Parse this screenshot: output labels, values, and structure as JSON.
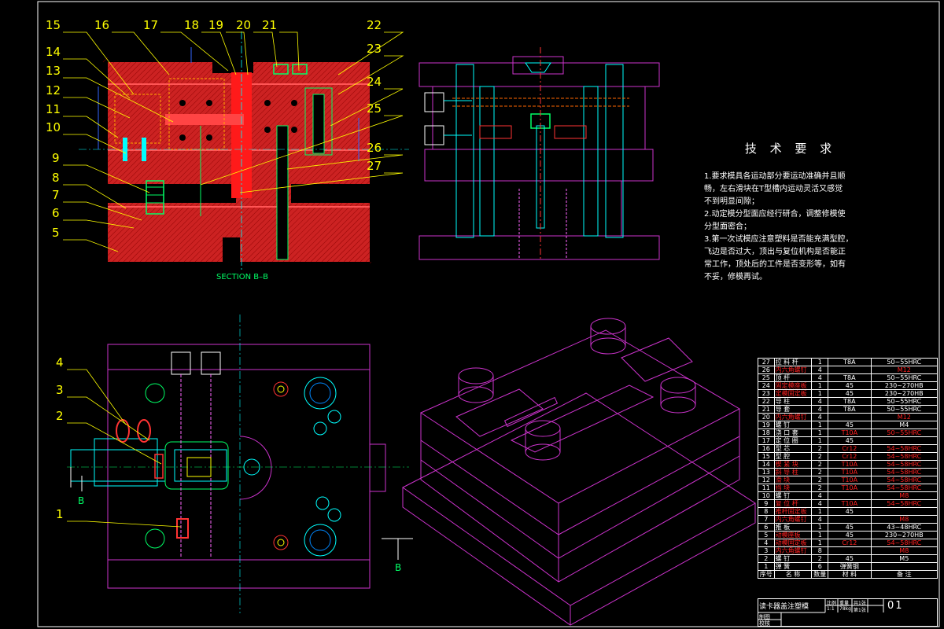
{
  "colors": {
    "background": "#000000",
    "frame": "#ffffff",
    "part_red": "#cc2222",
    "leader_yellow": "#ffff00",
    "outline_magenta": "#cc33cc",
    "outline_cyan": "#00ffff",
    "dim_green": "#00ff66",
    "text_white": "#ffffff"
  },
  "section_label": "SECTION B–B",
  "section_markers": [
    "B",
    "B"
  ],
  "callouts_top": [
    "15",
    "16",
    "17",
    "18",
    "19",
    "20",
    "21",
    "22",
    "23",
    "14",
    "13",
    "12",
    "11",
    "10",
    "24",
    "25",
    "26",
    "27",
    "9",
    "8",
    "7",
    "6",
    "5"
  ],
  "callouts_bottom": [
    "4",
    "3",
    "2",
    "1"
  ],
  "tech": {
    "title": "技 术 要 求",
    "lines": [
      "1.要求模具各运动部分要运动准确并且顺",
      "畅，左右滑块在T型槽内运动灵活又感觉",
      "不到明显间隙；",
      "2.动定模分型面应经行研合，调整修模使",
      "分型面密合；",
      "3.第一次试模应注意塑料是否能充满型腔，",
      "飞边是否过大，顶出与复位机构是否能正",
      "常工作，顶处后的工件是否变形等，如有",
      "不妥，修模再试。"
    ]
  },
  "bom": {
    "rows": [
      {
        "no": "27",
        "name": "拉 料 杆",
        "qty": "1",
        "mat": "T8A",
        "note": "50~55HRC"
      },
      {
        "no": "26",
        "name": "内六角螺钉",
        "qty": "4",
        "mat": "",
        "note": "M12"
      },
      {
        "no": "25",
        "name": "顶 杆",
        "qty": "4",
        "mat": "T8A",
        "note": "50~55HRC"
      },
      {
        "no": "24",
        "name": "固定模座板",
        "qty": "1",
        "mat": "45",
        "note": "230~270HB"
      },
      {
        "no": "23",
        "name": "定模固定板",
        "qty": "1",
        "mat": "45",
        "note": "230~270HB"
      },
      {
        "no": "22",
        "name": "导 柱",
        "qty": "4",
        "mat": "T8A",
        "note": "50~55HRC"
      },
      {
        "no": "21",
        "name": "导 套",
        "qty": "4",
        "mat": "T8A",
        "note": "50~55HRC"
      },
      {
        "no": "20",
        "name": "内六角螺钉",
        "qty": "4",
        "mat": "",
        "note": "M12"
      },
      {
        "no": "19",
        "name": "螺 钉",
        "qty": "1",
        "mat": "45",
        "note": "M4"
      },
      {
        "no": "18",
        "name": "浇 口 套",
        "qty": "1",
        "mat": "T10A",
        "note": "50~55HRC"
      },
      {
        "no": "17",
        "name": "定 位 圈",
        "qty": "1",
        "mat": "45",
        "note": ""
      },
      {
        "no": "16",
        "name": "型 芯",
        "qty": "2",
        "mat": "Cr12",
        "note": "54~58HRC"
      },
      {
        "no": "15",
        "name": "型 腔",
        "qty": "2",
        "mat": "Cr12",
        "note": "54~58HRC"
      },
      {
        "no": "14",
        "name": "楔 紧 块",
        "qty": "2",
        "mat": "T10A",
        "note": "54~58HRC"
      },
      {
        "no": "13",
        "name": "斜 导 柱",
        "qty": "2",
        "mat": "T10A",
        "note": "54~58HRC"
      },
      {
        "no": "12",
        "name": "滑 块",
        "qty": "2",
        "mat": "T10A",
        "note": "54~58HRC"
      },
      {
        "no": "11",
        "name": "挡 块",
        "qty": "2",
        "mat": "T10A",
        "note": "54~58HRC"
      },
      {
        "no": "10",
        "name": "螺 钉",
        "qty": "4",
        "mat": "",
        "note": "M8"
      },
      {
        "no": "9",
        "name": "复 位 杆",
        "qty": "4",
        "mat": "T10A",
        "note": "54~58HRC"
      },
      {
        "no": "8",
        "name": "推杆固定板",
        "qty": "1",
        "mat": "45",
        "note": ""
      },
      {
        "no": "7",
        "name": "内六角螺钉",
        "qty": "4",
        "mat": "",
        "note": "M8"
      },
      {
        "no": "6",
        "name": "推 板",
        "qty": "1",
        "mat": "45",
        "note": "43~48HRC"
      },
      {
        "no": "5",
        "name": "动模座板",
        "qty": "1",
        "mat": "45",
        "note": "230~270HB"
      },
      {
        "no": "4",
        "name": "动模固定板",
        "qty": "1",
        "mat": "Cr12",
        "note": "54~58HRC"
      },
      {
        "no": "3",
        "name": "内六角螺钉",
        "qty": "8",
        "mat": "",
        "note": "M8"
      },
      {
        "no": "2",
        "name": "螺 钉",
        "qty": "2",
        "mat": "45",
        "note": "M5"
      },
      {
        "no": "1",
        "name": "弹 簧",
        "qty": "6",
        "mat": "弹簧钢",
        "note": ""
      }
    ],
    "header": {
      "no": "序号",
      "name": "名 称",
      "qty": "数量",
      "mat": "材 料",
      "note": "备 注"
    }
  },
  "title_block": {
    "name": "读卡器盖注塑模",
    "scale_label": "比例",
    "scale": "1:1",
    "weight_label": "重量",
    "weight": "78kg",
    "sheets": "共1张",
    "sheet_no": "第1张",
    "code": "01",
    "drawn": "制图",
    "checked": "校核"
  }
}
